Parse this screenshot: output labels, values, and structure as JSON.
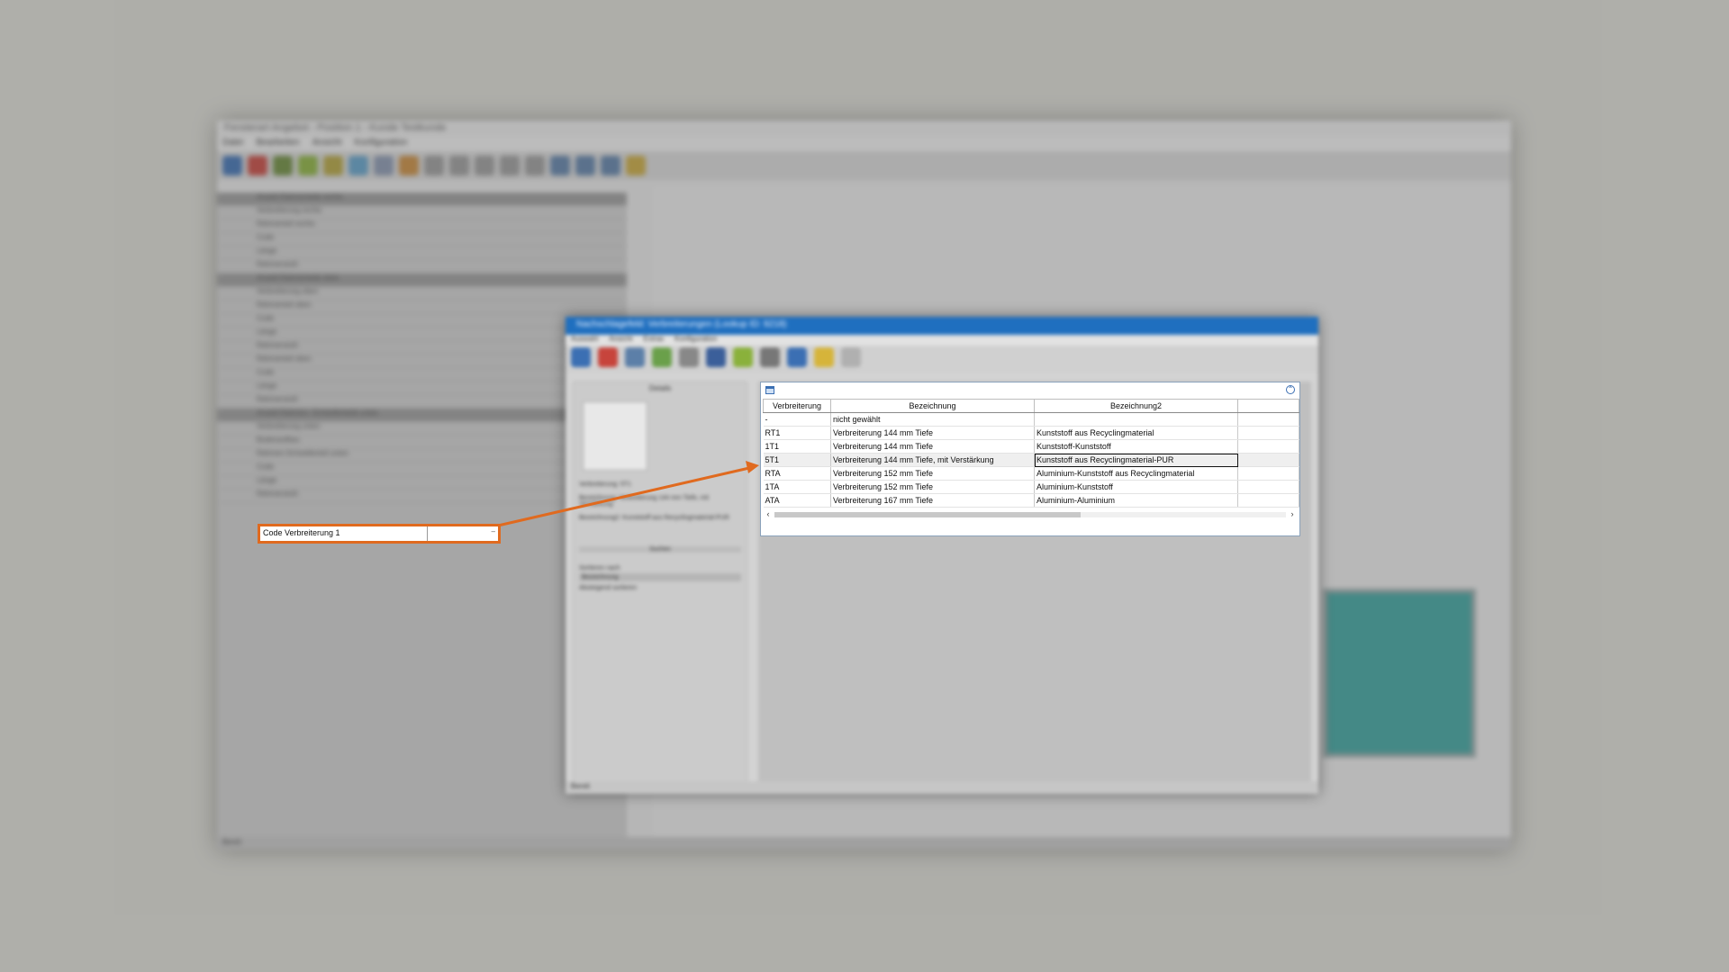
{
  "background_app": {
    "window_title": "Fensterart Angebot - Position 1 - Kunde Testkunde",
    "menu": [
      "Datei",
      "Bearbeiten",
      "Ansicht",
      "Konfiguration"
    ],
    "left_rows": [
      "Anzahl Rahmenteile rechts",
      "Verbreiterung rechts",
      "Rahmenteil rechts",
      "Code",
      "Länge",
      "Rahmenstoß",
      "Anzahl Rahmenteile oben",
      "Verbreiterung oben",
      "Rahmenteil oben",
      "Code",
      "Länge",
      "Rahmenstoß",
      "Rahmenteil oben",
      "Code",
      "Länge",
      "Rahmenstoß",
      "Anzahl Rahmen- Schwellenteile unten",
      "Verbreiterung unten",
      "Bodenaufbau",
      "Rahmen-Schwellenteil unten",
      "Code",
      "Länge",
      "Rahmenstoß"
    ],
    "status_bar": "Bereit"
  },
  "highlighted_field": {
    "label": "Code Verbreiterung 1",
    "value": ""
  },
  "dialog": {
    "title": "Nachschlagefeld: Verbreiterungen (Lookup ID: 9218)",
    "menu": [
      "Auswahl",
      "Ansicht",
      "Extras",
      "Konfiguration"
    ],
    "side_title": "Details",
    "side_lines": [
      "Verbreiterung: 5T1",
      "Bezeichnung: Verbreiterung 144 mm Tiefe, mit Verstärkung",
      "Bezeichnung2: Kunststoff aus Recyclingmaterial-PUR"
    ],
    "search_label": "Suchen",
    "sort_label": "Sortieren nach",
    "sort_value": "Bezeichnung",
    "sort_desc_label": "Absteigend sortieren",
    "status": "Bereit"
  },
  "lookup": {
    "columns": [
      "Verbreiterung",
      "Bezeichnung",
      "Bezeichnung2",
      ""
    ],
    "rows": [
      [
        "-",
        "nicht gewählt",
        "",
        ""
      ],
      [
        "RT1",
        "Verbreiterung 144 mm Tiefe",
        "Kunststoff aus Recyclingmaterial",
        ""
      ],
      [
        "1T1",
        "Verbreiterung 144 mm Tiefe",
        "Kunststoff-Kunststoff",
        ""
      ],
      [
        "5T1",
        "Verbreiterung 144 mm Tiefe, mit Verstärkung",
        "Kunststoff aus Recyclingmaterial-PUR",
        ""
      ],
      [
        "RTA",
        "Verbreiterung 152 mm Tiefe",
        "Aluminium-Kunststoff aus Recyclingmaterial",
        ""
      ],
      [
        "1TA",
        "Verbreiterung 152 mm Tiefe",
        "Aluminium-Kunststoff",
        ""
      ],
      [
        "ATA",
        "Verbreiterung 167 mm Tiefe",
        "Aluminium-Aluminium",
        ""
      ]
    ],
    "selected_row": 3,
    "scroll_left": "‹",
    "scroll_right": "›"
  },
  "colors": {
    "highlight": "#e06a1f",
    "dialog_title": "#1f6fbf",
    "preview_fill": "#3aa39f"
  },
  "icons": [
    "grid-icon",
    "collapse-up-icon",
    "arrow-pointer"
  ]
}
